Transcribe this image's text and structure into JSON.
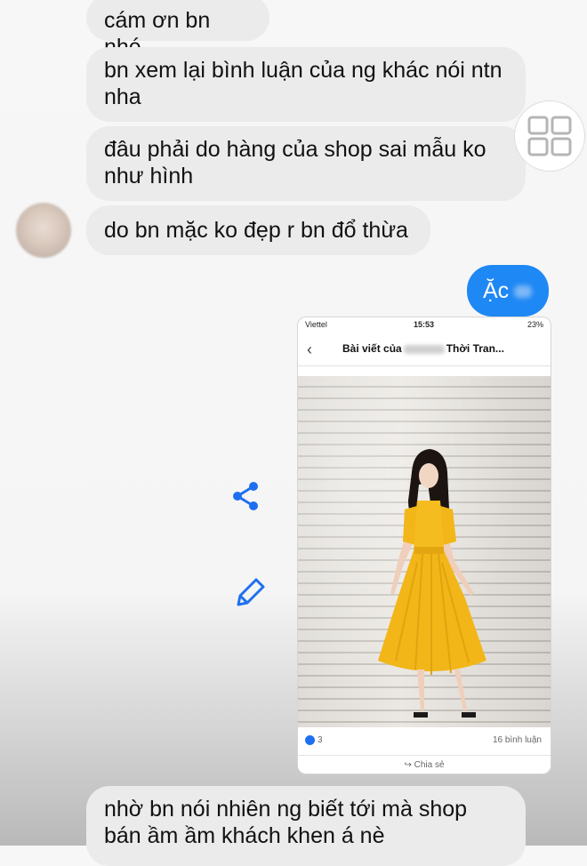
{
  "messages": [
    {
      "text": "cám ơn bn nhé"
    },
    {
      "text": "bn xem lại bình luận của ng khác nói ntn nha"
    },
    {
      "text": "đâu phải do hàng của shop sai mẫu ko như hình"
    },
    {
      "text": "do bn mặc ko đẹp r bn đổ thừa"
    },
    {
      "text": "nhờ bn nói nhiên ng biết tới mà shop bán ầm ầm khách khen á nè"
    }
  ],
  "sent_message": {
    "text": "Ặc"
  },
  "icons": {
    "gallery": "gallery-grid-icon",
    "share": "share-icon",
    "edit": "pencil-icon"
  },
  "screenshot": {
    "carrier": "Viettel",
    "time": "15:53",
    "battery": "23%",
    "title_prefix": "Bài viết của",
    "title_suffix": "Thời Tran...",
    "likes": "3",
    "comments": "16 bình luận",
    "share_label": "Chia sẻ"
  },
  "colors": {
    "sent_bubble": "#1e88f5",
    "received_bubble": "#ebebeb",
    "icon_blue": "#1e6ff0",
    "dress": "#f2b619"
  }
}
